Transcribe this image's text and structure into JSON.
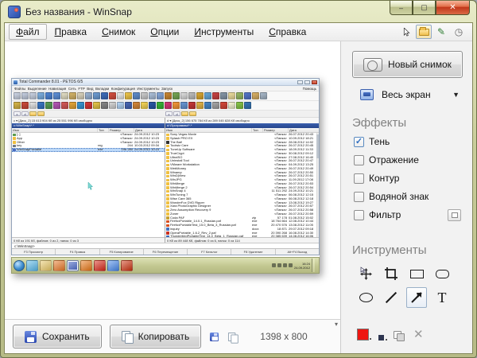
{
  "window": {
    "title": "Без названия - WinSnap",
    "controls": {
      "minimize": "minimize",
      "maximize": "maximize",
      "close": "close"
    }
  },
  "menu": {
    "items": [
      "Файл",
      "Правка",
      "Снимок",
      "Опции",
      "Инструменты",
      "Справка"
    ]
  },
  "menu_toolbar_icons": [
    "cursor-tool-icon",
    "new-snapshot-icon",
    "edit-annotate-icon",
    "timer-icon"
  ],
  "right_panel": {
    "new_snapshot": "Новый снимок",
    "capture_mode": "Весь экран",
    "effects_title": "Эффекты",
    "effects": [
      {
        "label": "Тень",
        "checked": true
      },
      {
        "label": "Отражение",
        "checked": false
      },
      {
        "label": "Контур",
        "checked": false
      },
      {
        "label": "Водяной знак",
        "checked": false
      },
      {
        "label": "Фильтр",
        "checked": false,
        "has_button": true
      }
    ],
    "tools_title": "Инструменты",
    "tools": [
      "move",
      "crop",
      "rectangle",
      "rounded-rectangle",
      "ellipse",
      "line",
      "arrow",
      "text"
    ],
    "selected_tool": "arrow",
    "color_swatch": "#ee1511"
  },
  "bottom_bar": {
    "save_label": "Сохранить",
    "copy_label": "Копировать",
    "dimensions": "1398 x 800"
  },
  "preview": {
    "cursor_color": "#7fd8d4",
    "tc": {
      "title": "Total Commander 8.01 - PETOS 6/5",
      "menu": "Файлы  Выделение  Навигация  Сеть  FTP  Вид  Вкладки  Конфигурация  Инструменты  Запуск",
      "menu_right": "Помощь",
      "toolbar_row1_colors": [
        "#cfd8e8",
        "#c8d2e4",
        "#cdd6e6",
        "#7fb2e5",
        "#4f86d8",
        "#5f92dc",
        "#e8e3c9",
        "#d8b76a",
        "#e0d9c2",
        "#9db7d8",
        "#6f9fd8",
        "#3f6fbf",
        "#d84f3f",
        "#efefef",
        "#f2c84b",
        "#5f8fd0",
        "#d0d0d0",
        "#b0c4de",
        "#88aadd",
        "#cc8833",
        "#77aa55",
        "#e0e0e0",
        "#c0c0c0",
        "#ddaa33",
        "#66aadd",
        "#cc4444",
        "#8899aa",
        "#f0e0a0",
        "#99bb66",
        "#5577cc",
        "#ddb366",
        "#aabbcc"
      ],
      "toolbar_row2_colors": [
        "#d9b84a",
        "#d04a3a",
        "#e8e8e8",
        "#3a78c8",
        "#58a058",
        "#b858b8",
        "#d85858",
        "#e8a838",
        "#3898d8",
        "#d83838",
        "#e8c848",
        "#888888",
        "#d8d8d8",
        "#b8d8f8",
        "#4868b8",
        "#d88838",
        "#f8d858",
        "#2858a8",
        "#38b838",
        "#d83878",
        "#f89838",
        "#6898d8",
        "#c83838",
        "#e8b848",
        "#4888c8",
        "#a8a8a8",
        "#d84838",
        "#f8f8d8",
        "#88c848",
        "#3878b8"
      ],
      "drive_buttons": [
        "c",
        "d"
      ],
      "left": {
        "drive_info": "c ▾  [Диск_2]  15 613 904 Кб из 25 551 996 Кб свободно",
        "path": "c:\\WinSnap\\*.*",
        "columns": [
          "Имя",
          "Тип",
          "Размер",
          "Дата"
        ],
        "rows": [
          {
            "name": "[..]",
            "type": "",
            "size": "<Папка>",
            "date": "24.09.2012 10:23",
            "kind": "up"
          },
          {
            "name": "App",
            "type": "",
            "size": "<Папка>",
            "date": "24.09.2012 10:23",
            "kind": "folder"
          },
          {
            "name": "Other",
            "type": "",
            "size": "<Папка>",
            "date": "24.09.2012 10:23",
            "kind": "folder"
          },
          {
            "name": "key",
            "type": "reg",
            "size": "244",
            "date": "10.03.2012 09:34",
            "kind": "file",
            "ic": "#707880"
          },
          {
            "name": "WinSnapPortable",
            "type": "exe",
            "size": "196 280",
            "date": "24.09.2012 10:23",
            "kind": "file",
            "ic": "#4a6ac0",
            "selected": true
          }
        ],
        "status": "0 Кб из 191 Кб, файлов: 0 из 2, папок: 0 из 3"
      },
      "right": {
        "drive_info": "d ▾  [Диск_2]  156 675 784 Кб из 289 045 828 Кб свободно",
        "path": "d:\\Программы\\*.*",
        "columns": [
          "Имя",
          "Тип",
          "Размер",
          "Дата"
        ],
        "rows": [
          {
            "name": "Sony Vegas Movie",
            "type": "",
            "size": "<Папка>",
            "date": "26.07.2012 20:43",
            "kind": "folder"
          },
          {
            "name": "Splash PRO EX",
            "type": "",
            "size": "<Папка>",
            "date": "10.09.2012 18:21",
            "kind": "folder"
          },
          {
            "name": "The Bat!",
            "type": "",
            "size": "<Папка>",
            "date": "28.08.2012 14:02",
            "kind": "folder",
            "ic": "#303030"
          },
          {
            "name": "Toolwiz Care",
            "type": "",
            "size": "<Папка>",
            "date": "26.07.2012 20:45",
            "kind": "folder"
          },
          {
            "name": "TuneUp Software",
            "type": "",
            "size": "<Папка>",
            "date": "18.09.2012 11:33",
            "kind": "folder"
          },
          {
            "name": "TrueCrypt",
            "type": "",
            "size": "<Папка>",
            "date": "30.08.2012 09:12",
            "kind": "folder"
          },
          {
            "name": "UltraISO",
            "type": "",
            "size": "<Папка>",
            "date": "27.08.2012 16:40",
            "kind": "folder"
          },
          {
            "name": "Uninstall Tool",
            "type": "",
            "size": "<Папка>",
            "date": "26.07.2012 20:47",
            "kind": "folder"
          },
          {
            "name": "VMware Workstation",
            "type": "",
            "size": "<Папка>",
            "date": "04.09.2012 13:25",
            "kind": "folder"
          },
          {
            "name": "WebMoney",
            "type": "",
            "size": "<Папка>",
            "date": "26.07.2012 20:49",
            "kind": "folder"
          },
          {
            "name": "Winamp",
            "type": "",
            "size": "<Папка>",
            "date": "26.07.2012 20:50",
            "kind": "folder"
          },
          {
            "name": "WinDjView",
            "type": "",
            "size": "<Папка>",
            "date": "26.07.2012 20:51",
            "kind": "folder"
          },
          {
            "name": "WinJPG",
            "type": "",
            "size": "<Папка>",
            "date": "11.09.2012 17:08",
            "kind": "folder"
          },
          {
            "name": "WinMerge",
            "type": "",
            "size": "<Папка>",
            "date": "26.07.2012 20:53",
            "kind": "folder"
          },
          {
            "name": "WinMerge 2",
            "type": "",
            "size": "<Папка>",
            "date": "26.07.2012 20:54",
            "kind": "folder"
          },
          {
            "name": "WinSnap 4",
            "type": "",
            "size": "11 511 292",
            "date": "24.09.2012 10:21",
            "kind": "folder"
          },
          {
            "name": "WinTuning 7",
            "type": "",
            "size": "<Папка>",
            "date": "06.08.2012 12:15",
            "kind": "folder"
          },
          {
            "name": "Wise Care 365",
            "type": "",
            "size": "<Папка>",
            "date": "06.08.2012 12:18",
            "kind": "folder"
          },
          {
            "name": "WonderFox DVD Ripper",
            "type": "",
            "size": "<Папка>",
            "date": "13.08.2012 19:27",
            "kind": "folder"
          },
          {
            "name": "Xara PhotoGraphic Designer",
            "type": "",
            "size": "<Папка>",
            "date": "26.07.2012 20:57",
            "kind": "folder"
          },
          {
            "name": "Zero Assumption Recovery 9",
            "type": "",
            "size": "<Папка>",
            "date": "26.07.2012 20:58",
            "kind": "folder"
          },
          {
            "name": "Zoner",
            "type": "",
            "size": "<Папка>",
            "date": "26.07.2012 20:59",
            "kind": "folder"
          },
          {
            "name": "Coda PAF",
            "type": "zip",
            "size": "57 178",
            "date": "01.08.2012 15:02",
            "kind": "file",
            "ic": "#c8a030"
          },
          {
            "name": "FirefoxPortable_14.0.1_Russian.paf",
            "type": "exe",
            "size": "18 764 664",
            "date": "12.08.2012 10:44",
            "kind": "file",
            "ic": "#d85020"
          },
          {
            "name": "FirefoxPortableTest_15.0_Beta_3_Russian.paf",
            "type": "exe",
            "size": "20 470 576",
            "date": "13.08.2012 11:05",
            "kind": "file",
            "ic": "#d85020"
          },
          {
            "name": "inquiry",
            "type": "docx",
            "size": "18 871",
            "date": "29.07.2012 09:18",
            "kind": "file",
            "ic": "#4070c0"
          },
          {
            "name": "OperaPortable_1.6.2_Rev_2.paf",
            "type": "exe",
            "size": "20 390 268",
            "date": "16.08.2012 14:30",
            "kind": "file",
            "ic": "#c83020"
          },
          {
            "name": "ThunderbirdPortableTest_14.0_Beta_1_Russian.paf",
            "type": "exe",
            "size": "20 385 639",
            "date": "14.08.2012 16:06",
            "kind": "file",
            "ic": "#3868b8"
          }
        ],
        "status": "0 Кб из 89 448 Кб, файлов: 0 из 6, папок: 0 из 114"
      },
      "cmdline": "c:\\WinSnap>",
      "fkeys": [
        "F3 Просмотр",
        "F4 Правка",
        "F5 Копирование",
        "F6 Перемещение",
        "F7 Каталог",
        "F8 Удаление",
        "Alt+F4 Выход"
      ]
    },
    "taskbar": {
      "start": "start-button",
      "icons": [
        {
          "name": "browser-icon",
          "color": "#58b8e8"
        },
        {
          "name": "folder-icon",
          "color": "#e8c868"
        },
        {
          "name": "media-player-icon",
          "color": "#e87828"
        },
        {
          "name": "winsnap-icon",
          "color": "#4868c8",
          "active": true
        },
        {
          "name": "firefox-icon",
          "color": "#e87818"
        },
        {
          "name": "opera-icon",
          "color": "#d82818"
        },
        {
          "name": "messenger-icon",
          "color": "#4888e8"
        },
        {
          "name": "app-red-icon",
          "color": "#cc3311"
        }
      ],
      "tray_icons": [
        "tray-icon",
        "tray-icon",
        "tray-icon",
        "tray-icon"
      ],
      "clock_time": "16:24",
      "clock_date": "24.09.2012"
    }
  }
}
